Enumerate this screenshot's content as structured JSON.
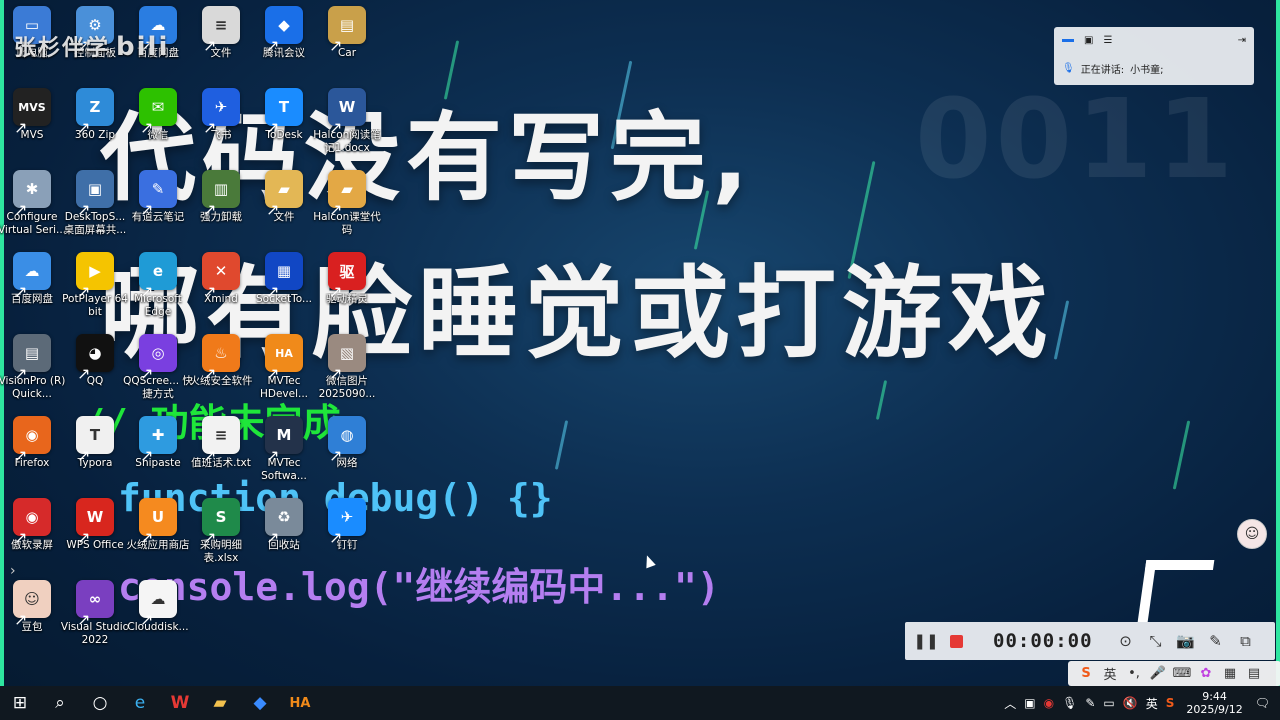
{
  "watermark": {
    "text": "张杉伴学",
    "brand": "bili"
  },
  "wallpaper": {
    "line1": "代码没有写完,",
    "line2": "哪有脸睡觉或打游戏",
    "comment": "// 功能未完成",
    "func": "function debug() {}",
    "console": "console.log(\"继续编码中...\")",
    "bignum": "0011"
  },
  "desktop_icons": [
    {
      "label": "此电脑",
      "icon": "computer-icon",
      "color": "#3b7bd6",
      "glyph": "▭"
    },
    {
      "label": "控制面板",
      "icon": "control-panel-icon",
      "color": "#4a90d9",
      "glyph": "⚙"
    },
    {
      "label": "百度网盘",
      "icon": "cloud-icon",
      "color": "#2a7de1",
      "glyph": "☁"
    },
    {
      "label": "文件",
      "icon": "document-icon",
      "color": "#d9d9d9",
      "glyph": "≡"
    },
    {
      "label": "腾讯会议",
      "icon": "tencent-meeting-icon",
      "color": "#1a6fe8",
      "glyph": "◆"
    },
    {
      "label": "Car",
      "icon": "folder-icon",
      "color": "#c9a04a",
      "glyph": "▤"
    },
    {
      "label": "MVS",
      "icon": "mvs-icon",
      "color": "#222",
      "glyph": "MVS"
    },
    {
      "label": "360 Zip",
      "icon": "zip-icon",
      "color": "#2e8bd8",
      "glyph": "Z"
    },
    {
      "label": "微信",
      "icon": "wechat-icon",
      "color": "#2dc100",
      "glyph": "✉"
    },
    {
      "label": "飞书",
      "icon": "feishu-icon",
      "color": "#1f5fe0",
      "glyph": "✈"
    },
    {
      "label": "ToDesk",
      "icon": "todesk-icon",
      "color": "#1a8cff",
      "glyph": "T"
    },
    {
      "label": "Halcon阅读笔记1.docx",
      "icon": "word-icon",
      "color": "#2b579a",
      "glyph": "W"
    },
    {
      "label": "Configure Virtual Seri...",
      "icon": "configure-icon",
      "color": "#8aa0b8",
      "glyph": "✱"
    },
    {
      "label": "DeskTopS... 桌面屏幕共...",
      "icon": "monitor-icon",
      "color": "#3f6fa8",
      "glyph": "▣"
    },
    {
      "label": "有道云笔记",
      "icon": "note-icon",
      "color": "#3a6fe0",
      "glyph": "✎"
    },
    {
      "label": "强力卸载",
      "icon": "uninstall-icon",
      "color": "#4a7a3a",
      "glyph": "▥"
    },
    {
      "label": "文件",
      "icon": "folder-icon",
      "color": "#e3b755",
      "glyph": "▰"
    },
    {
      "label": "Halcon课堂代码",
      "icon": "folder-icon",
      "color": "#e3a845",
      "glyph": "▰"
    },
    {
      "label": "百度网盘",
      "icon": "baidu-netdisk-icon",
      "color": "#3a8ee6",
      "glyph": "☁"
    },
    {
      "label": "PotPlayer 64 bit",
      "icon": "potplayer-icon",
      "color": "#f5c400",
      "glyph": "▶"
    },
    {
      "label": "Microsoft Edge",
      "icon": "edge-icon",
      "color": "#1f9bd6",
      "glyph": "e"
    },
    {
      "label": "Xmind",
      "icon": "xmind-icon",
      "color": "#e0492e",
      "glyph": "✕"
    },
    {
      "label": "SocketTo...",
      "icon": "socket-icon",
      "color": "#1147c4",
      "glyph": "▦"
    },
    {
      "label": "驱动精灵",
      "icon": "driver-icon",
      "color": "#d92020",
      "glyph": "驱"
    },
    {
      "label": "VisionPro (R) Quick...",
      "icon": "visionpro-icon",
      "color": "#5c6a78",
      "glyph": "▤"
    },
    {
      "label": "QQ",
      "icon": "qq-icon",
      "color": "#111",
      "glyph": "◕"
    },
    {
      "label": "QQScree... 快捷方式",
      "icon": "screenshot-icon",
      "color": "#7a3fe0",
      "glyph": "◎"
    },
    {
      "label": "火绒安全软件",
      "icon": "huorong-icon",
      "color": "#f07a1a",
      "glyph": "♨"
    },
    {
      "label": "MVTec HDevel...",
      "icon": "ha-icon",
      "color": "#f08a1a",
      "glyph": "HA"
    },
    {
      "label": "微信图片 2025090...",
      "icon": "image-icon",
      "color": "#9a8a80",
      "glyph": "▧"
    },
    {
      "label": "Firefox",
      "icon": "firefox-icon",
      "color": "#e8661c",
      "glyph": "◉"
    },
    {
      "label": "Typora",
      "icon": "typora-icon",
      "color": "#f0f0f0",
      "glyph": "T"
    },
    {
      "label": "Snipaste",
      "icon": "snipaste-icon",
      "color": "#2e9be0",
      "glyph": "✚"
    },
    {
      "label": "值班话术.txt",
      "icon": "txt-icon",
      "color": "#f2f2f2",
      "glyph": "≡"
    },
    {
      "label": "MVTec Softwa...",
      "icon": "mvtec-icon",
      "color": "#23324a",
      "glyph": "M"
    },
    {
      "label": "网络",
      "icon": "network-icon",
      "color": "#2f7fd6",
      "glyph": "◍"
    },
    {
      "label": "傲软录屏",
      "icon": "recorder-icon",
      "color": "#d62a2a",
      "glyph": "◉"
    },
    {
      "label": "WPS Office",
      "icon": "wps-icon",
      "color": "#d8261e",
      "glyph": "W"
    },
    {
      "label": "火绒应用商店",
      "icon": "store-icon",
      "color": "#f58a1f",
      "glyph": "U"
    },
    {
      "label": "采购明细表.xlsx",
      "icon": "excel-icon",
      "color": "#1f8a4a",
      "glyph": "S"
    },
    {
      "label": "回收站",
      "icon": "recycle-bin-icon",
      "color": "#7a8a9a",
      "glyph": "♻"
    },
    {
      "label": "钉钉",
      "icon": "dingtalk-icon",
      "color": "#1a8cff",
      "glyph": "✈"
    },
    {
      "label": "豆包",
      "icon": "doubao-icon",
      "color": "#f0d0c0",
      "glyph": "☺"
    },
    {
      "label": "Visual Studio 2022",
      "icon": "visual-studio-icon",
      "color": "#7a3fc0",
      "glyph": "∞"
    },
    {
      "label": "Clouddisk...",
      "icon": "clouddisk-icon",
      "color": "#f5f5f5",
      "glyph": "☁"
    }
  ],
  "meeting": {
    "speaking_label": "正在讲话:",
    "speaker": "小书童;"
  },
  "recorder": {
    "time": "00:00:00"
  },
  "ime": {
    "lang": "英"
  },
  "tray": {
    "lang": "英",
    "time": "9:44",
    "date": "2025/9/12"
  },
  "colors": {
    "accent_green": "#2ee6a0",
    "record_red": "#e53935",
    "comment_green": "#1fe63a",
    "func_cyan": "#4fc3f7",
    "console_purple": "#b47ef0"
  }
}
